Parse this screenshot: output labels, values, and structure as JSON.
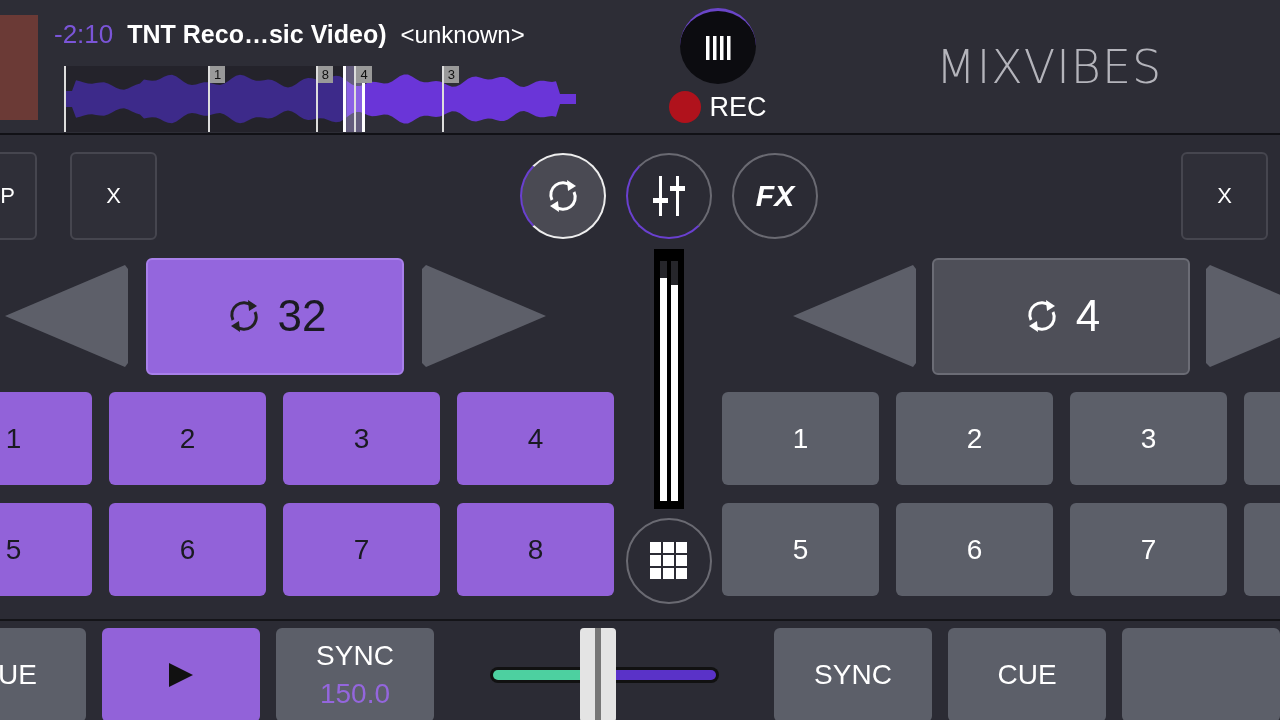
{
  "now_playing": {
    "time": "-2:10",
    "title": "TNT Reco…sic Video)",
    "artist": "<unknown>"
  },
  "waveform": {
    "level": 0.55,
    "markers": [
      {
        "label": "1"
      },
      {
        "label": "8"
      },
      {
        "label": "4"
      },
      {
        "label": "3"
      }
    ]
  },
  "record": {
    "label": "REC"
  },
  "logo": "MIXVIBES",
  "mode_buttons": [
    {
      "kind": "loop",
      "selected": true
    },
    {
      "kind": "mixer",
      "selected": false
    },
    {
      "kind": "fx",
      "label": "FX",
      "selected": false
    }
  ],
  "vu_meter": [
    {
      "level": 0.93
    },
    {
      "level": 0.9
    }
  ],
  "crossfader": {
    "level": 0.47
  },
  "decks": [
    {
      "active": true,
      "top_button": "P",
      "close": "X",
      "loop": "32",
      "pad_rows": [
        [
          "1",
          "2",
          "3",
          "4"
        ],
        [
          "5",
          "6",
          "7",
          "8"
        ]
      ],
      "cue": "UE",
      "playing": true,
      "sync": "SYNC",
      "bpm": "150.0"
    },
    {
      "active": false,
      "close": "X",
      "loop": "4",
      "pad_rows": [
        [
          "1",
          "2",
          "3"
        ],
        [
          "5",
          "6",
          "7"
        ]
      ],
      "sync": "SYNC",
      "cue": "CUE"
    }
  ]
}
